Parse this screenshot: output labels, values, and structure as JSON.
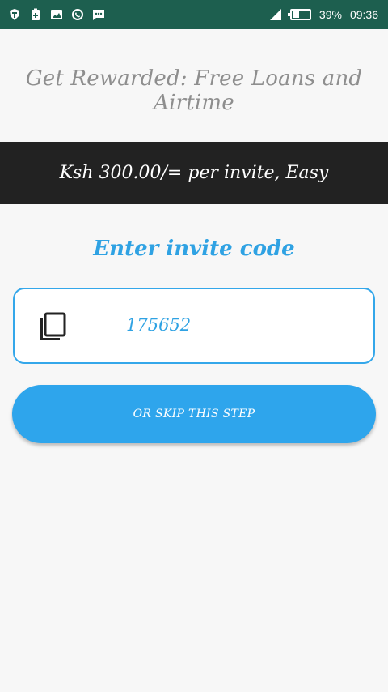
{
  "status_bar": {
    "left_icons": [
      "shield-app-icon",
      "battery-saver-icon",
      "image-icon",
      "whatsapp-icon",
      "message-icon"
    ],
    "signal": "signal-icon",
    "battery_percent": "39%",
    "time": "09:36"
  },
  "app": {
    "title": "Get Rewarded: Free Loans and Airtime"
  },
  "promo": {
    "text": "Ksh 300.00/= per invite, Easy"
  },
  "invite": {
    "heading": "Enter invite code",
    "code": "175652",
    "copy_icon": "copy-icon"
  },
  "actions": {
    "skip_label": "OR SKIP THIS STEP"
  },
  "colors": {
    "status_bar": "#1d5f4f",
    "accent": "#2ea5ec",
    "banner": "#222222",
    "title_gray": "#8e8e8e",
    "background": "#f7f7f7"
  }
}
